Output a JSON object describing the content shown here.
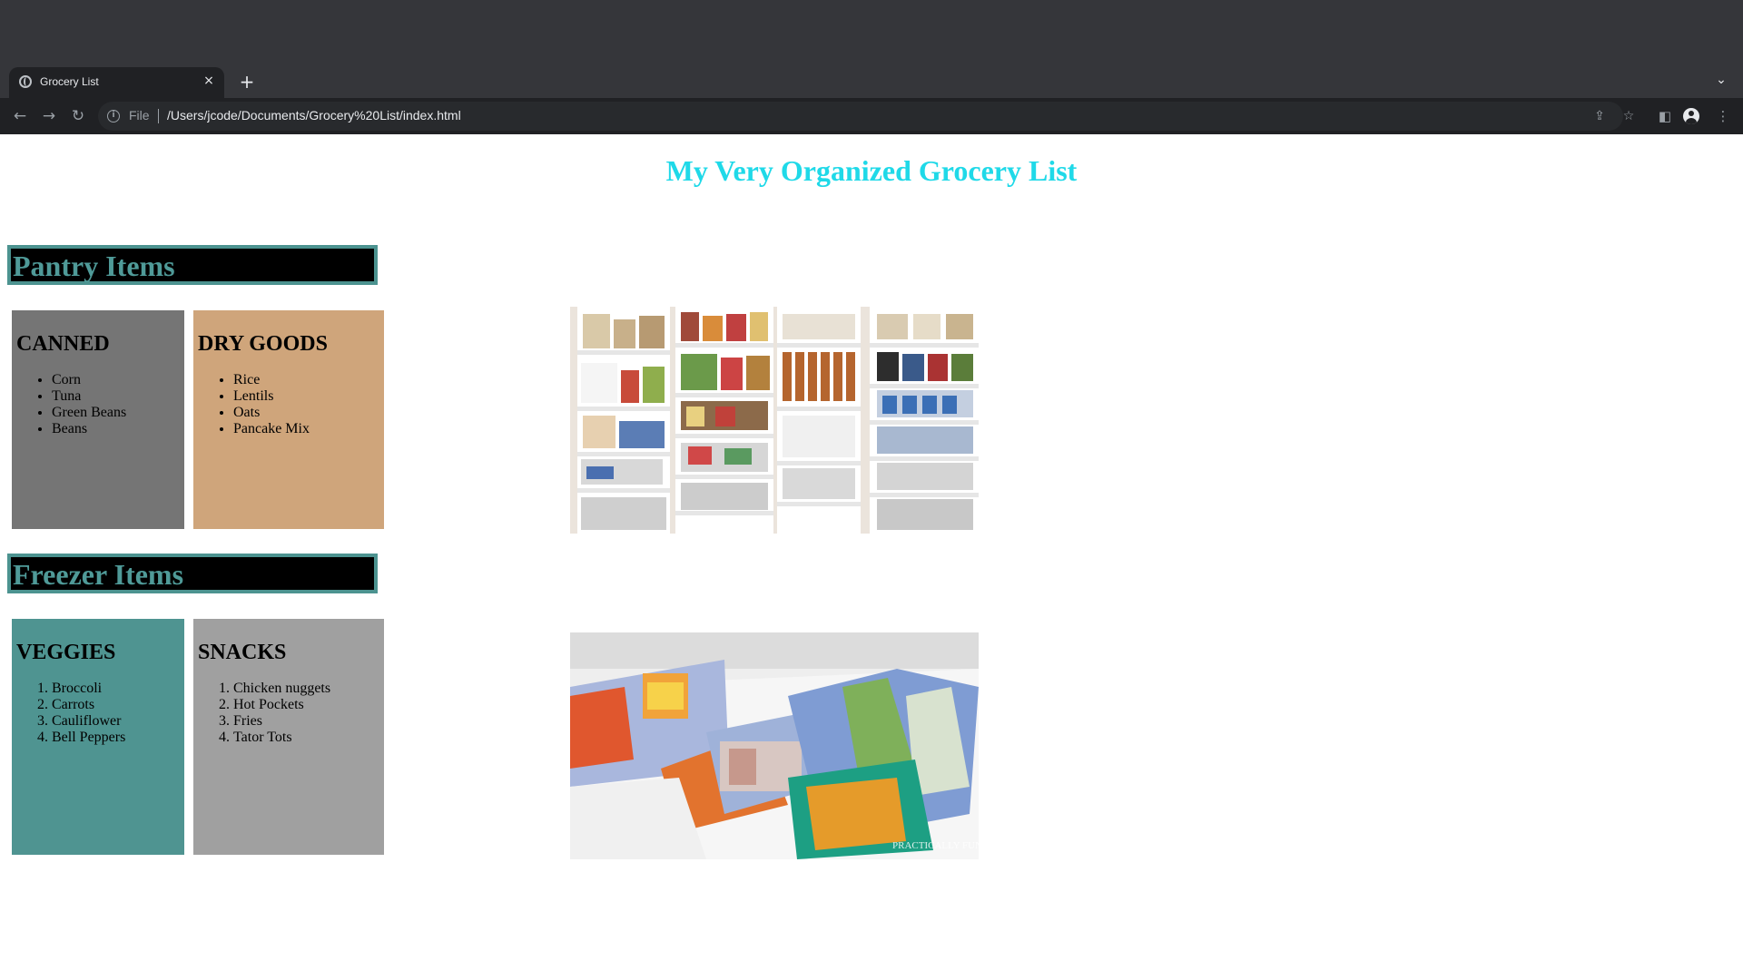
{
  "browser": {
    "tab": {
      "title": "Grocery List",
      "close_symbol": "×"
    },
    "new_tab_symbol": "+",
    "tab_list_symbol": "⌄",
    "nav": {
      "back": "←",
      "forward": "→",
      "reload": "↻"
    },
    "omnibox": {
      "scheme_label": "File",
      "url": "/Users/jcode/Documents/Grocery%20List/index.html",
      "share_icon": "⇪",
      "bookmark_icon": "☆"
    },
    "side_panel_icon": "◧",
    "menu_icon": "⋮"
  },
  "page": {
    "title": "My Very Organized Grocery List",
    "colors": {
      "title": "#1fd9e8",
      "section_text": "#4f9a98",
      "section_bg": "#000000",
      "canned_bg": "#757575",
      "dry_goods_bg": "#cfa57b",
      "veggies_bg": "#4f9491",
      "snacks_bg": "#a0a0a0"
    },
    "pantry": {
      "heading": "Pantry Items",
      "canned": {
        "heading": "CANNED",
        "items": [
          "Corn",
          "Tuna",
          "Green Beans",
          "Beans"
        ]
      },
      "dry_goods": {
        "heading": "DRY GOODS",
        "items": [
          "Rice",
          "Lentils",
          "Oats",
          "Pancake Mix"
        ]
      },
      "image_description": "pantry-shelves-photo"
    },
    "freezer": {
      "heading": "Freezer Items",
      "veggies": {
        "heading": "VEGGIES",
        "items": [
          "Broccoli",
          "Carrots",
          "Cauliflower",
          "Bell Peppers"
        ]
      },
      "snacks": {
        "heading": "SNACKS",
        "items": [
          "Chicken nuggets",
          "Hot Pockets",
          "Fries",
          "Tator Tots"
        ]
      },
      "watermark": "PRACTICALLY FUNCTIONAL",
      "image_description": "chest-freezer-photo"
    }
  }
}
